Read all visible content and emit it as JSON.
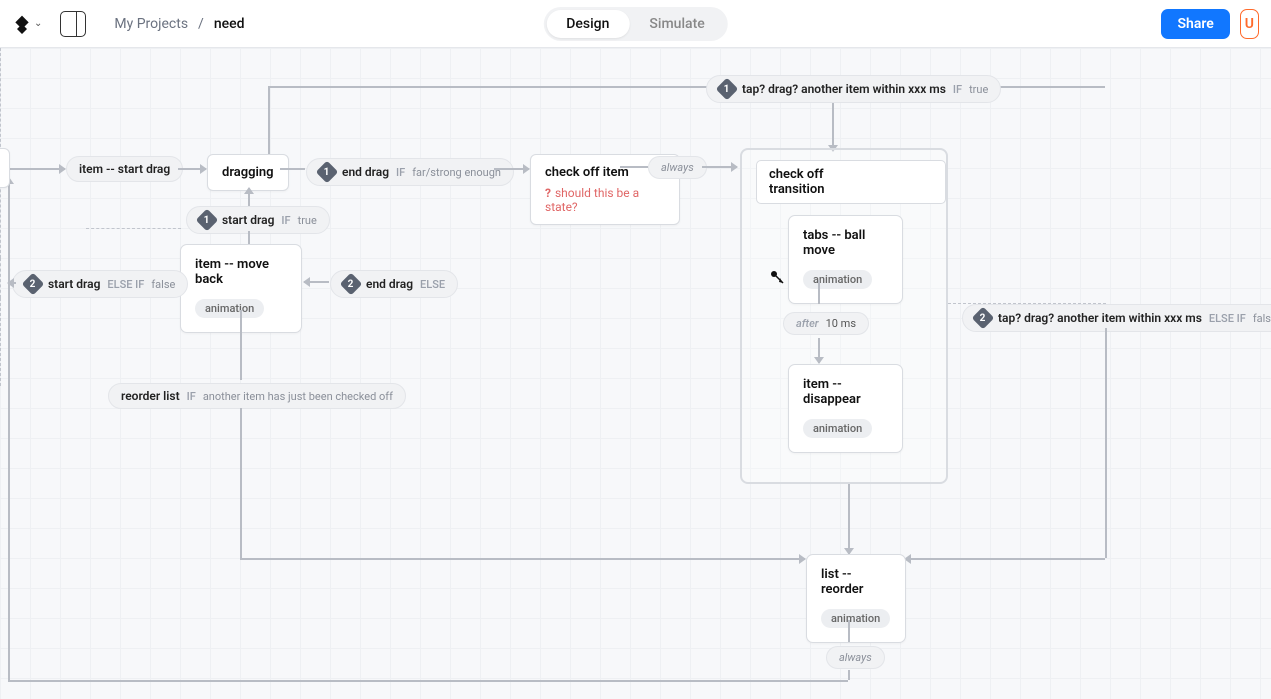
{
  "header": {
    "breadcrumb_root": "My Projects",
    "breadcrumb_sep": "/",
    "breadcrumb_current": "need",
    "mode_design": "Design",
    "mode_simulate": "Simulate",
    "share": "Share",
    "danger": "U"
  },
  "nodes": {
    "dragging": "dragging",
    "check_off_item": "check off item",
    "check_off_item_q": "should this be a state?",
    "item_move_back": "item -- move back",
    "animation_tag": "animation",
    "check_off_transition": "check off transition",
    "tabs_ball_move": "tabs -- ball move",
    "item_disappear": "item -- disappear",
    "list_reorder": "list -- reorder"
  },
  "transitions": {
    "item_start_drag": {
      "event": "item -- start drag"
    },
    "end_drag_far": {
      "num": "1",
      "event": "end drag",
      "kw": "IF",
      "cond": "far/strong enough"
    },
    "always1": {
      "event": "always"
    },
    "tap_drag_true": {
      "num": "1",
      "event": "tap? drag? another item within xxx ms",
      "kw": "IF",
      "cond": "true"
    },
    "tap_drag_false": {
      "num": "2",
      "event": "tap? drag? another item within xxx ms",
      "kw": "ELSE IF",
      "cond": "false"
    },
    "start_drag_true": {
      "num": "1",
      "event": "start drag",
      "kw": "IF",
      "cond": "true"
    },
    "start_drag_false": {
      "num": "2",
      "event": "start drag",
      "kw": "ELSE IF",
      "cond": "false"
    },
    "end_drag_else": {
      "num": "2",
      "event": "end drag",
      "kw": "ELSE"
    },
    "reorder_list": {
      "event": "reorder list",
      "kw": "IF",
      "cond": "another item has just been checked off"
    },
    "after_10": {
      "kw": "after",
      "cond": "10 ms"
    },
    "always2": {
      "event": "always"
    }
  }
}
